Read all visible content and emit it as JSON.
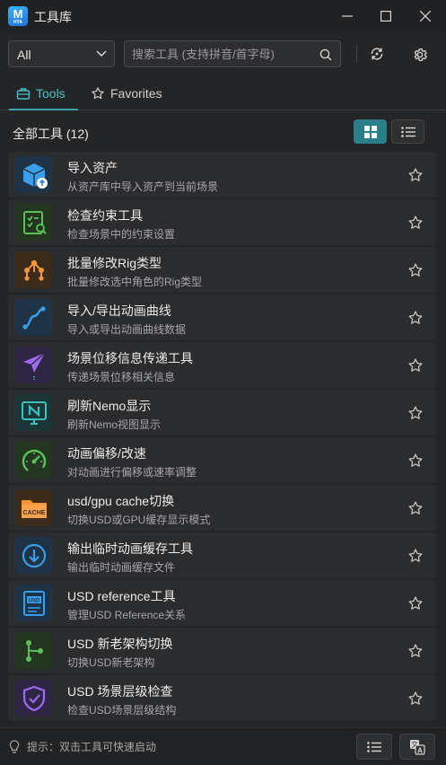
{
  "window": {
    "logo_letter": "M",
    "logo_sub": "HYA",
    "title": "工具库"
  },
  "filter": {
    "selected": "All"
  },
  "search": {
    "placeholder": "搜索工具 (支持拼音/首字母)"
  },
  "tabs": [
    {
      "label": "Tools",
      "active": true
    },
    {
      "label": "Favorites",
      "active": false
    }
  ],
  "section": {
    "title": "全部工具 (12)"
  },
  "tools": [
    {
      "name": "导入资产",
      "desc": "从资产库中导入资产到当前场景",
      "icon": "import-box-icon",
      "color": "#3b9ee8"
    },
    {
      "name": "检查约束工具",
      "desc": "检查场景中的约束设置",
      "icon": "checklist-icon",
      "color": "#5cc15c"
    },
    {
      "name": "批量修改Rig类型",
      "desc": "批量修改选中角色的Rig类型",
      "icon": "rig-nodes-icon",
      "color": "#f0953a"
    },
    {
      "name": "导入/导出动画曲线",
      "desc": "导入或导出动画曲线数据",
      "icon": "curve-icon",
      "color": "#3b9ee8"
    },
    {
      "name": "场景位移信息传递工具",
      "desc": "传递场景位移相关信息",
      "icon": "paper-plane-icon",
      "color": "#9b6cf0"
    },
    {
      "name": "刷新Nemo显示",
      "desc": "刷新Nemo视图显示",
      "icon": "nemo-monitor-icon",
      "color": "#3fbfc0"
    },
    {
      "name": "动画偏移/改速",
      "desc": "对动画进行偏移或速率调整",
      "icon": "speedometer-icon",
      "color": "#5cc15c"
    },
    {
      "name": "usd/gpu cache切换",
      "desc": "切换USD或GPU缓存显示模式",
      "icon": "cache-folder-icon",
      "color": "#f0953a"
    },
    {
      "name": "输出临时动画缓存工具",
      "desc": "输出临时动画缓存文件",
      "icon": "download-circle-icon",
      "color": "#3b9ee8"
    },
    {
      "name": "USD reference工具",
      "desc": "管理USD Reference关系",
      "icon": "usd-file-icon",
      "color": "#3b9ee8"
    },
    {
      "name": "USD 新老架构切换",
      "desc": "切换USD新老架构",
      "icon": "branch-icon",
      "color": "#5cc15c"
    },
    {
      "name": "USD 场景层级检查",
      "desc": "检查USD场景层级结构",
      "icon": "shield-check-icon",
      "color": "#9b6cf0"
    }
  ],
  "footer": {
    "hint": "提示：双击工具可快速启动"
  }
}
